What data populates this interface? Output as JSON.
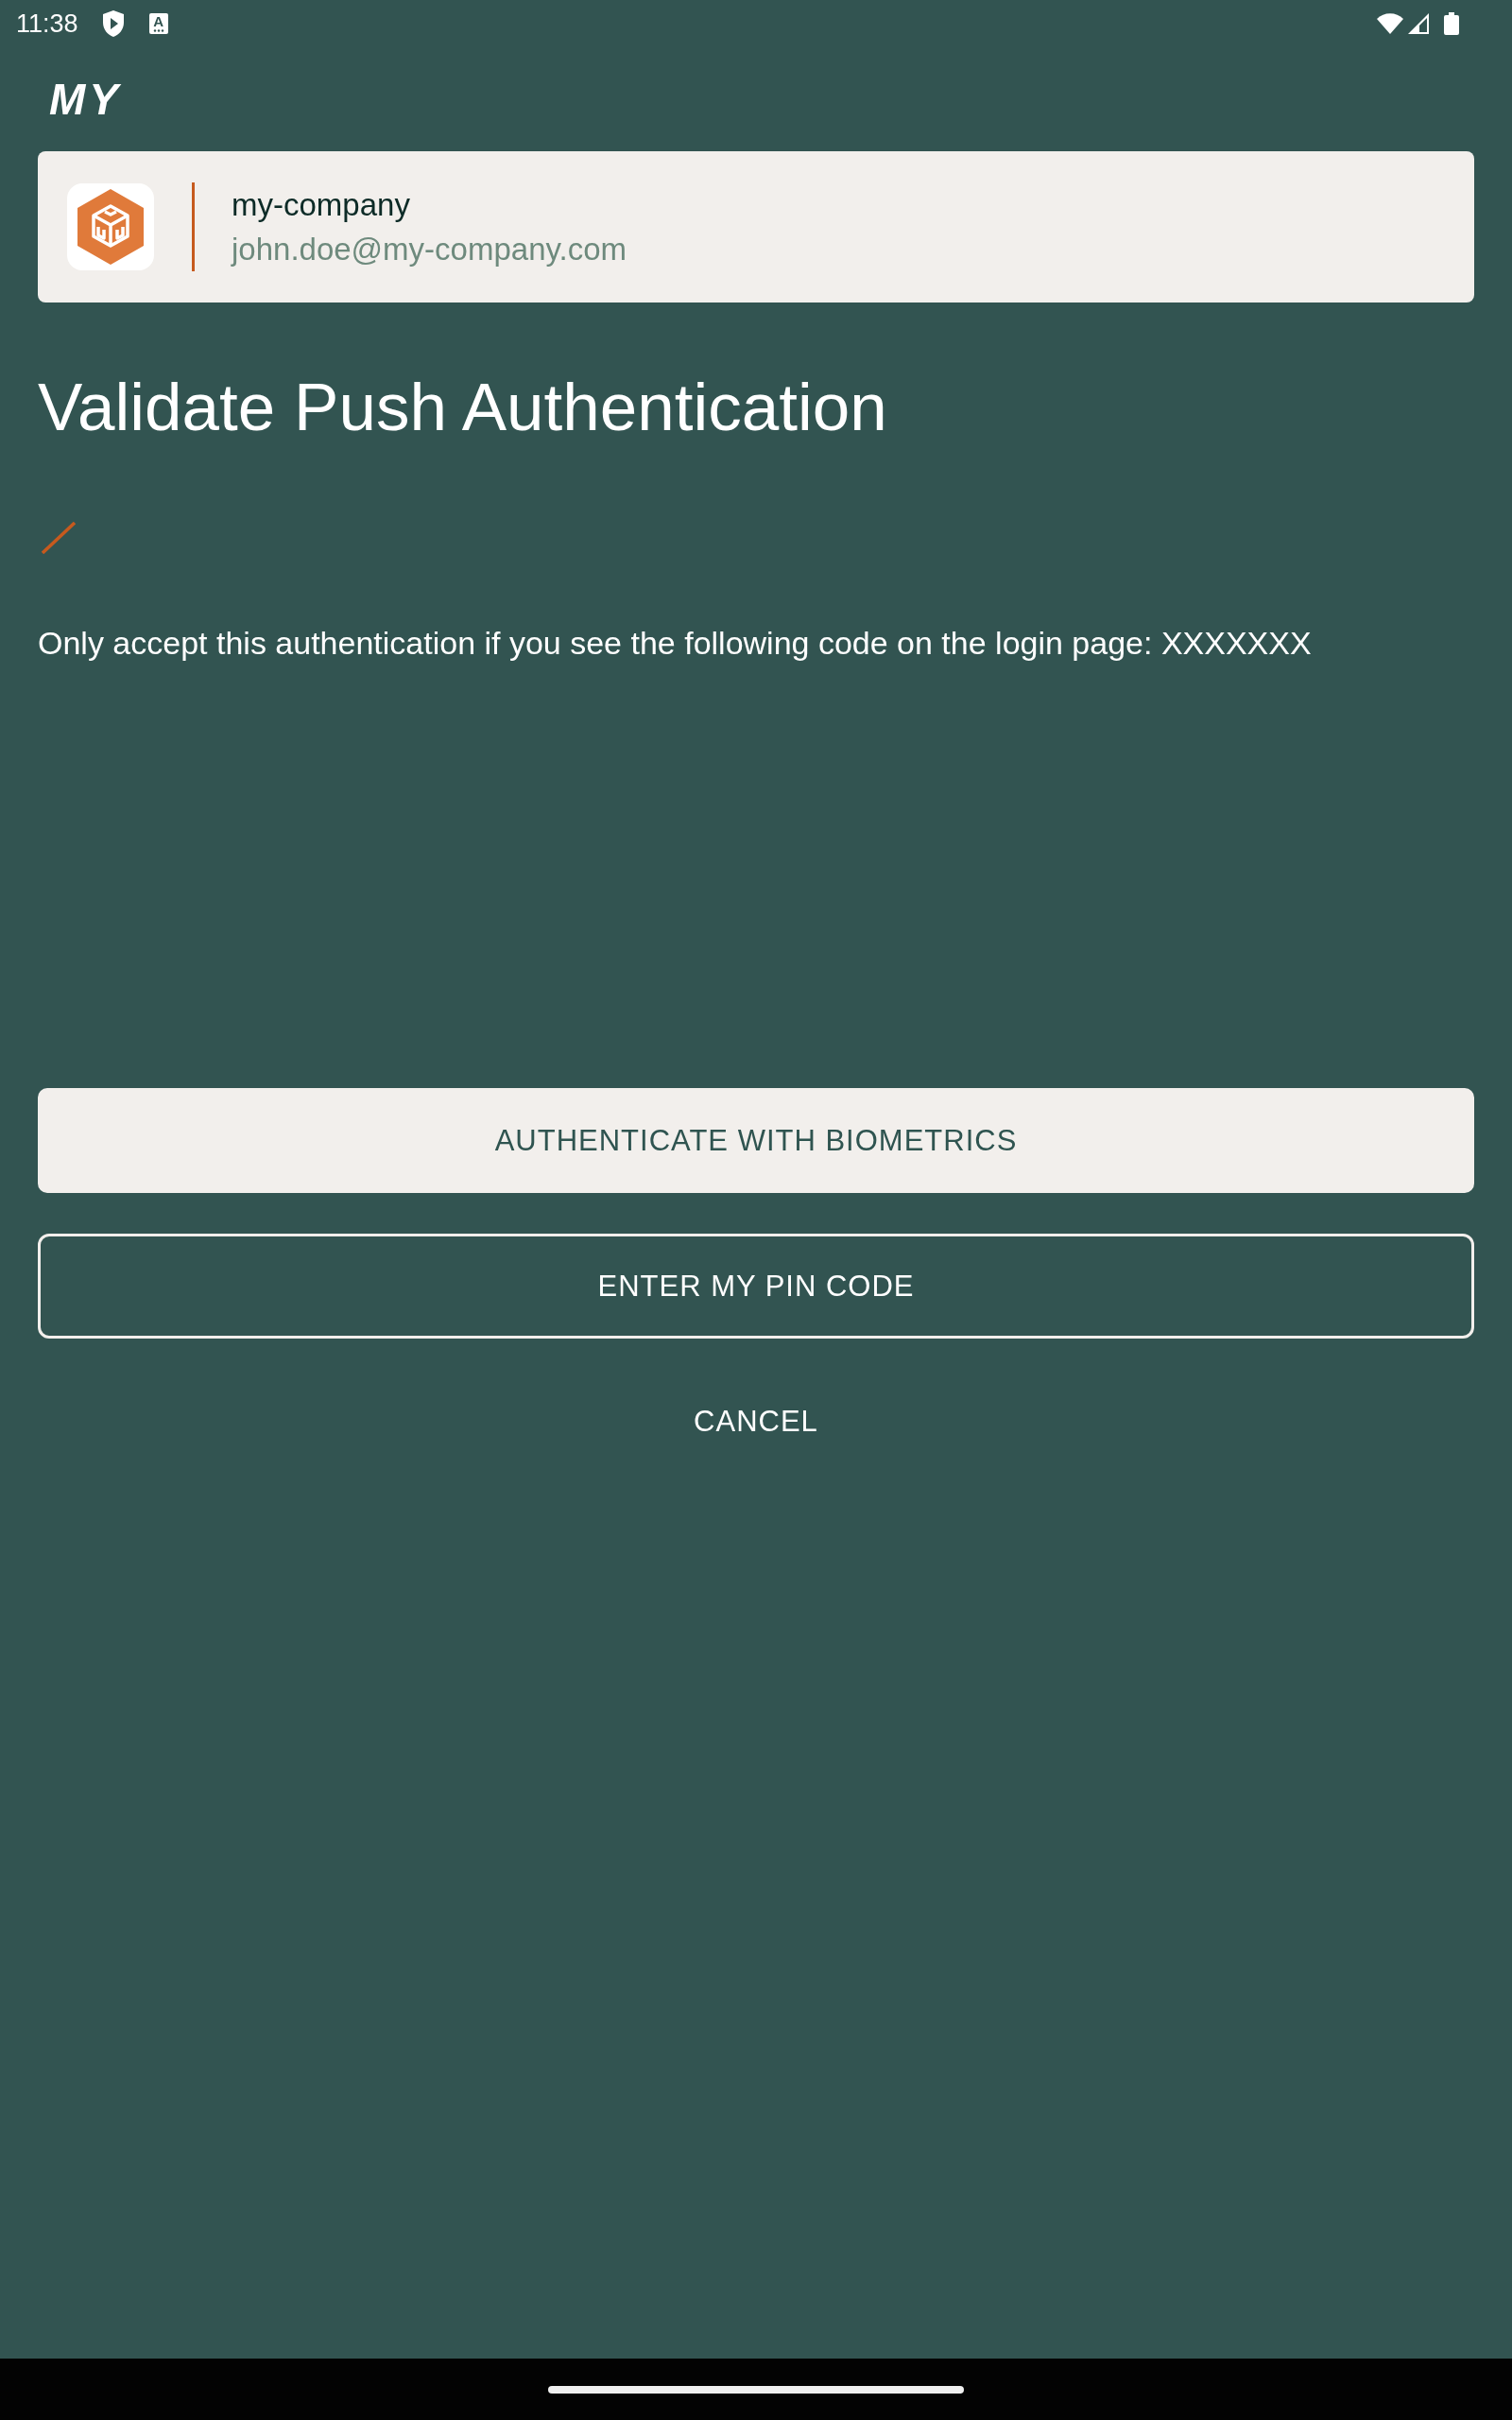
{
  "status_bar": {
    "time": "11:38",
    "notification_icon_text": "A"
  },
  "logo": {
    "text": "MY"
  },
  "account": {
    "organization": "my-company",
    "email": "john.doe@my-company.com"
  },
  "title": "Validate Push Authentication",
  "message": "Only accept this authentication if you see the following code on the login page: XXXXXXX",
  "actions": [
    {
      "label": "AUTHENTICATE WITH BIOMETRICS",
      "kind": "filled"
    },
    {
      "label": "ENTER MY PIN CODE",
      "kind": "outlined"
    },
    {
      "label": "CANCEL",
      "kind": "text"
    }
  ]
}
